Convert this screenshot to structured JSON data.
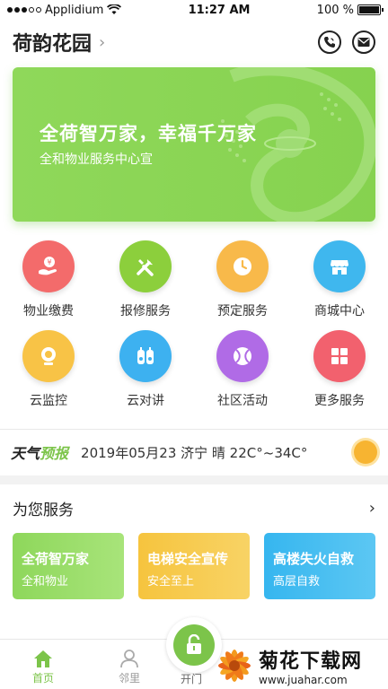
{
  "status_bar": {
    "carrier": "Applidium",
    "time": "11:27 AM",
    "battery": "100 %"
  },
  "header": {
    "title": "荷韵花园",
    "phone_icon": "phone-icon",
    "mail_icon": "mail-icon"
  },
  "banner": {
    "headline": "全荷智万家，幸福千万家",
    "subline": "全和物业服务中心宣",
    "color": "#8fd85a"
  },
  "grid": {
    "items": [
      {
        "label": "物业缴费",
        "icon": "payment-icon",
        "color": "#f36b6b"
      },
      {
        "label": "报修服务",
        "icon": "tools-icon",
        "color": "#8ccf3c"
      },
      {
        "label": "预定服务",
        "icon": "clock-icon",
        "color": "#f8b94a"
      },
      {
        "label": "商城中心",
        "icon": "store-icon",
        "color": "#3fb7ee"
      },
      {
        "label": "云监控",
        "icon": "camera-icon",
        "color": "#f8c346"
      },
      {
        "label": "云对讲",
        "icon": "intercom-icon",
        "color": "#3db1f0"
      },
      {
        "label": "社区活动",
        "icon": "ball-icon",
        "color": "#b06be6"
      },
      {
        "label": "更多服务",
        "icon": "grid-icon",
        "color": "#f2616e"
      }
    ]
  },
  "weather": {
    "tag_a": "天气",
    "tag_b": "预报",
    "info": "2019年05月23  济宁  晴 22C°~34C°",
    "icon": "sun-icon"
  },
  "services": {
    "title": "为您服务",
    "more_icon": "chevron-right-icon",
    "cards": [
      {
        "title": "全荷智万家",
        "subtitle": "全和物业"
      },
      {
        "title": "电梯安全宣传",
        "subtitle": "安全至上"
      },
      {
        "title": "高楼失火自救",
        "subtitle": "高层自救"
      }
    ]
  },
  "tabbar": {
    "home": "首页",
    "neighbor": "邻里",
    "open_door": "开门",
    "accent": "#7cc44a"
  },
  "watermark": {
    "text": "菊花下载网",
    "url": "www.juahar.com"
  }
}
